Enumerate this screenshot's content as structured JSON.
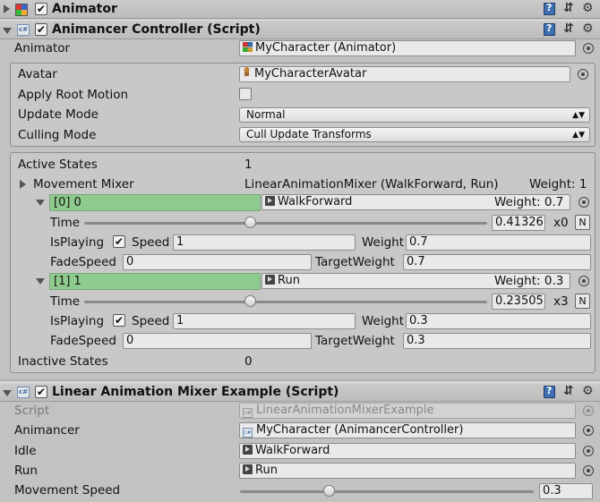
{
  "animator_component": {
    "title": "Animator",
    "enabled": true
  },
  "controller_component": {
    "title": "Animancer Controller (Script)",
    "enabled": true,
    "animator_label": "Animator",
    "animator_value": "MyCharacter (Animator)",
    "avatar_label": "Avatar",
    "avatar_value": "MyCharacterAvatar",
    "apply_root_motion_label": "Apply Root Motion",
    "apply_root_motion": false,
    "update_mode_label": "Update Mode",
    "update_mode_value": "Normal",
    "culling_mode_label": "Culling Mode",
    "culling_mode_value": "Cull Update Transforms"
  },
  "states": {
    "active_states_label": "Active States",
    "active_states_value": "1",
    "mixer_label": "Movement Mixer",
    "mixer_value": "LinearAnimationMixer (WalkForward, Run)",
    "mixer_weight": "Weight: 1",
    "children": [
      {
        "index_label": "[0] 0",
        "clip": "WalkForward",
        "weight_label": "Weight: 0.7",
        "time_label": "Time",
        "time_value": "0.41326",
        "time_fraction": 0.41,
        "loop_count": "x0",
        "n_label": "N",
        "is_playing_label": "IsPlaying",
        "is_playing": true,
        "speed_label": "Speed",
        "speed_value": "1",
        "weight_field_label": "Weight",
        "weight_value": "0.7",
        "fade_speed_label": "FadeSpeed",
        "fade_speed_value": "0",
        "target_weight_label": "TargetWeight",
        "target_weight_value": "0.7"
      },
      {
        "index_label": "[1] 1",
        "clip": "Run",
        "weight_label": "Weight: 0.3",
        "time_label": "Time",
        "time_value": "0.23505",
        "time_fraction": 0.41,
        "loop_count": "x3",
        "n_label": "N",
        "is_playing_label": "IsPlaying",
        "is_playing": true,
        "speed_label": "Speed",
        "speed_value": "1",
        "weight_field_label": "Weight",
        "weight_value": "0.3",
        "fade_speed_label": "FadeSpeed",
        "fade_speed_value": "0",
        "target_weight_label": "TargetWeight",
        "target_weight_value": "0.3"
      }
    ],
    "inactive_states_label": "Inactive States",
    "inactive_states_value": "0"
  },
  "example_component": {
    "title": "Linear Animation Mixer Example (Script)",
    "enabled": true,
    "script_label": "Script",
    "script_value": "LinearAnimationMixerExample",
    "animancer_label": "Animancer",
    "animancer_value": "MyCharacter (AnimancerController)",
    "idle_label": "Idle",
    "idle_value": "WalkForward",
    "run_label": "Run",
    "run_value": "Run",
    "movement_speed_label": "Movement Speed",
    "movement_speed_value": "0.3",
    "movement_speed_fraction": 0.3
  },
  "checkmark": "✔",
  "colors": {
    "green_highlight": "#8fcb8f",
    "panel_bg": "#c2c2c2"
  }
}
